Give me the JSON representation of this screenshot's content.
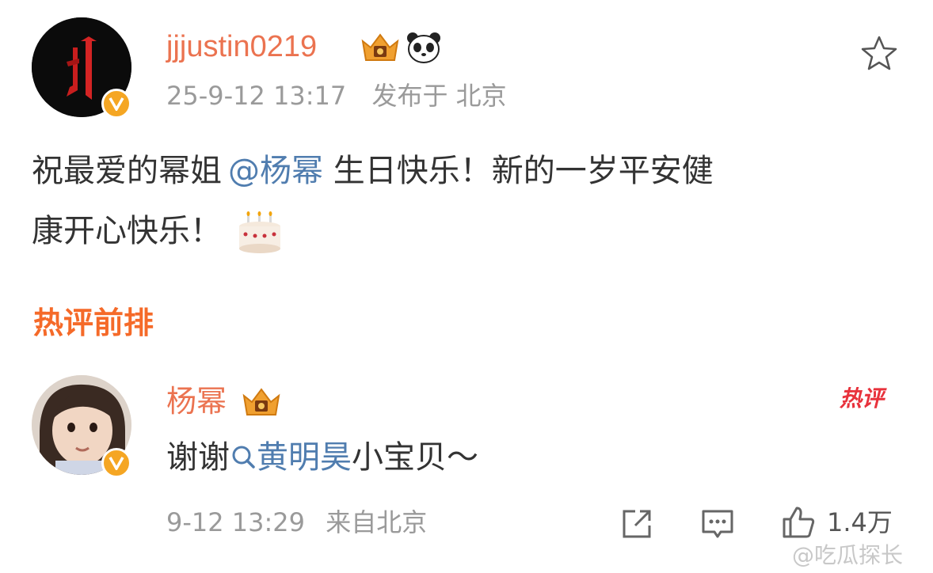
{
  "post": {
    "username": "jjjustin0219",
    "level_badge_icon": "crown-level-icon",
    "emoji_badge_icon": "panda-icon",
    "timestamp": "25-9-12 13:17",
    "location": "发布于 北京",
    "text_before_mention": "祝最爱的幂姐",
    "mention": "@杨幂",
    "text_line1_rest": " 生日快乐！新的一岁平安健",
    "text_line2": "康开心快乐！",
    "emoji": "cake-icon"
  },
  "section": {
    "title": "热评前排"
  },
  "comment": {
    "username": "杨幂",
    "level_badge_icon": "crown-level-icon",
    "text_prefix": "谢谢",
    "search_link": "黄明昊",
    "text_suffix": "小宝贝～",
    "hot_badge": "热评",
    "timestamp": "9-12 13:29",
    "source": "来自北京",
    "like_count": "1.4万"
  },
  "watermark": "@吃瓜探长",
  "colors": {
    "username": "#eb7350",
    "mention": "#507daf",
    "section_title": "#f56a29",
    "verified": "#f5a623",
    "hot_badge": "#e8323c"
  }
}
